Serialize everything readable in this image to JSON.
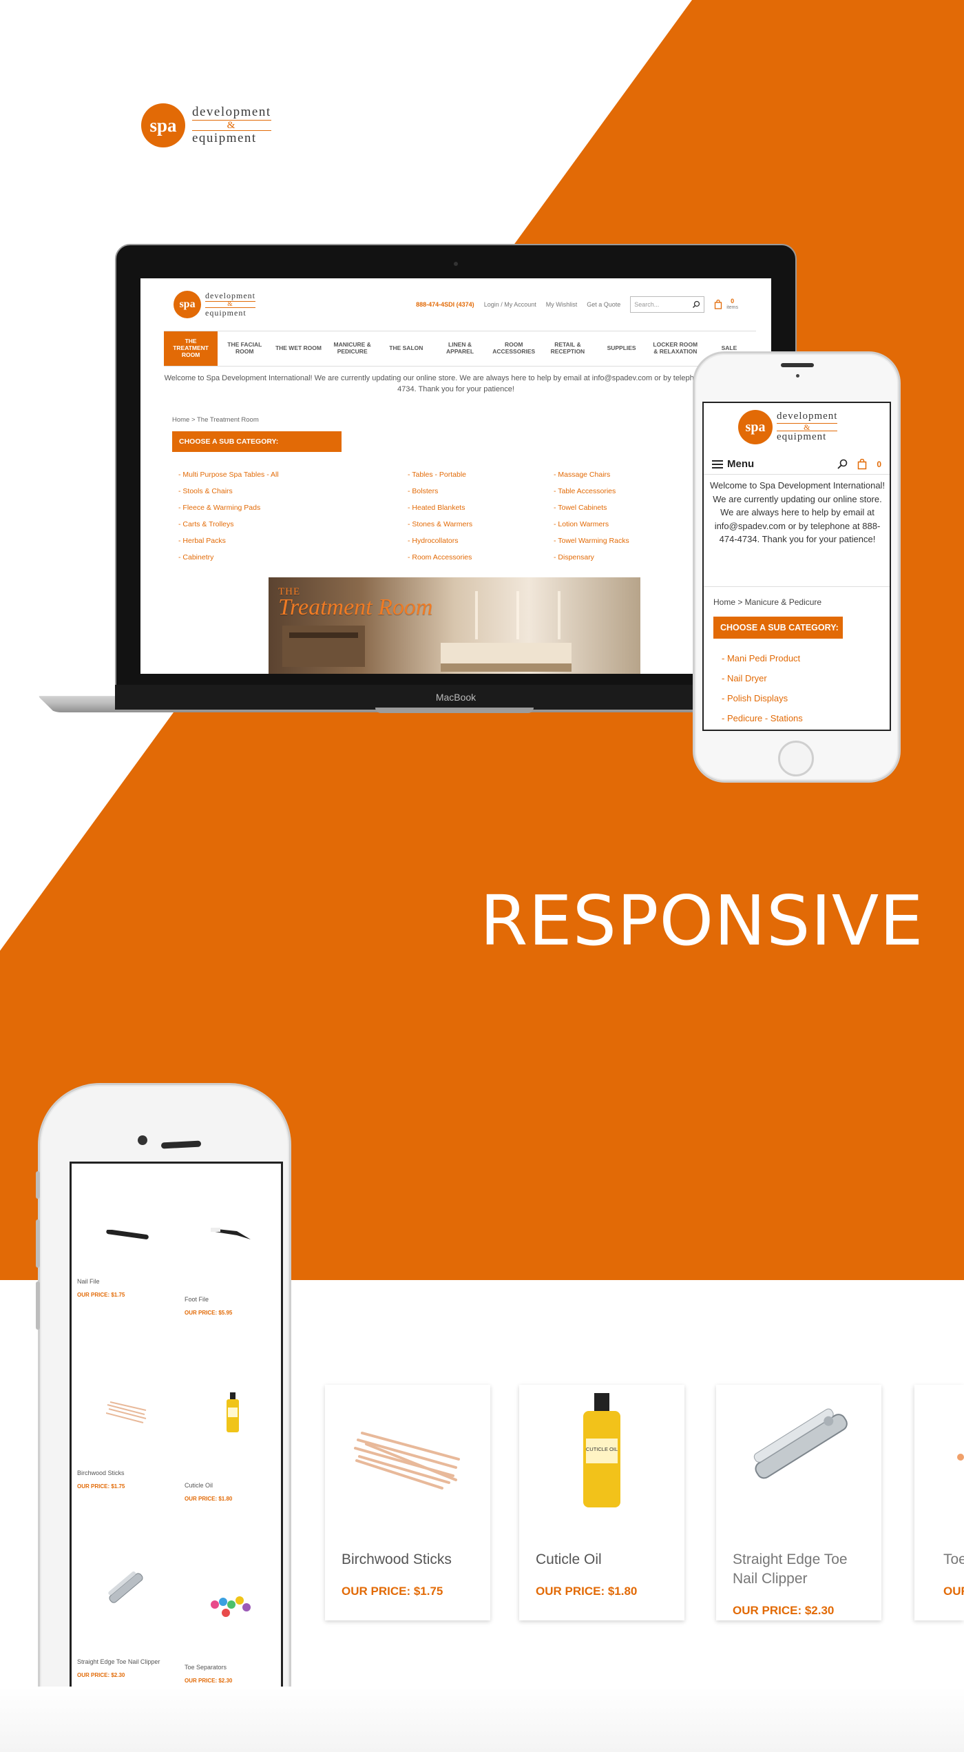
{
  "colors": {
    "accent": "#e26a06",
    "white": "#ffffff"
  },
  "brand": {
    "seal": "spa",
    "word1": "development",
    "amp": "&",
    "word2": "equipment"
  },
  "headline": "RESPONSIVE",
  "laptop": {
    "brand_label": "MacBook",
    "site": {
      "phone": "888-474-4SDI (4374)",
      "links": [
        "Login / My Account",
        "My Wishlist",
        "Get a Quote"
      ],
      "search_placeholder": "Search...",
      "cart_count": "0",
      "cart_label": "items",
      "nav": [
        "THE TREATMENT ROOM",
        "THE FACIAL ROOM",
        "THE WET ROOM",
        "MANICURE & PEDICURE",
        "THE SALON",
        "LINEN & APPAREL",
        "ROOM ACCESSORIES",
        "RETAIL & RECEPTION",
        "SUPPLIES",
        "LOCKER ROOM & RELAXATION",
        "SALE"
      ],
      "welcome": "Welcome to Spa Development International! We are currently updating our online store. We are always here to help by email at info@spadev.com or by telephone at 888-474-4734. Thank you for your patience!",
      "breadcrumb": "Home > The Treatment Room",
      "subcategory_heading": "CHOOSE A SUB CATEGORY:",
      "columns": [
        [
          "- Multi Purpose Spa Tables - All",
          "- Stools & Chairs",
          "- Fleece & Warming Pads",
          "- Carts & Trolleys",
          "- Herbal Packs",
          "- Cabinetry"
        ],
        [
          "- Tables - Portable",
          "- Bolsters",
          "- Heated Blankets",
          "- Stones & Warmers",
          "- Hydrocollators",
          "- Room Accessories"
        ],
        [
          "- Massage Chairs",
          "- Table Accessories",
          "- Towel Cabinets",
          "- Lotion Warmers",
          "- Towel Warming Racks",
          "- Dispensary"
        ]
      ],
      "banner": {
        "line1": "THE",
        "line2": "Treatment Room"
      }
    }
  },
  "mobile": {
    "menu_label": "Menu",
    "cart_count": "0",
    "welcome": "Welcome to Spa Development International! We are currently updating our online store. We are always here to help by email at info@spadev.com or by telephone at 888-474-4734. Thank you for your patience!",
    "breadcrumb": "Home > Manicure & Pedicure",
    "subcategory_heading": "CHOOSE A SUB CATEGORY:",
    "items": [
      "- Mani Pedi Product",
      "- Nail Dryer",
      "- Polish Displays",
      "- Pedicure - Stations"
    ]
  },
  "big_phone": {
    "products": [
      {
        "name": "Nail File",
        "price": "OUR PRICE: $1.75"
      },
      {
        "name": "Foot File",
        "price": "OUR PRICE: $5.95"
      },
      {
        "name": "Birchwood Sticks",
        "price": "OUR PRICE: $1.75"
      },
      {
        "name": "Cuticle Oil",
        "price": "OUR PRICE: $1.80"
      },
      {
        "name": "Straight Edge Toe Nail Clipper",
        "price": "OUR PRICE: $2.30"
      },
      {
        "name": "Toe Separators",
        "price": "OUR PRICE: $2.30"
      }
    ]
  },
  "cards": [
    {
      "name": "Birchwood Sticks",
      "price": "OUR PRICE: $1.75"
    },
    {
      "name": "Cuticle Oil",
      "price": "OUR PRICE: $1.80"
    },
    {
      "name": "Straight Edge Toe Nail Clipper",
      "price": "OUR PRICE: $2.30"
    },
    {
      "name": "Toe",
      "price": "OUR"
    }
  ],
  "cuticle_label": "CUTICLE OIL"
}
